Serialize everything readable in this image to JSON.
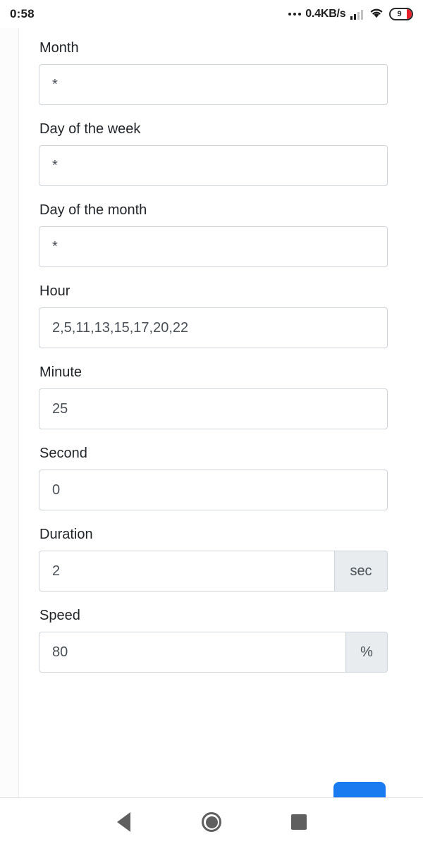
{
  "status_bar": {
    "clock": "0:58",
    "network_speed": "0.4KB/s",
    "battery_level": "9",
    "icons": {
      "more": "three-dots-icon",
      "signal": "signal-bars-icon",
      "wifi": "wifi-icon",
      "battery": "battery-icon"
    }
  },
  "form": {
    "fields": [
      {
        "label": "Month",
        "value": "*",
        "addon": ""
      },
      {
        "label": "Day of the week",
        "value": "*",
        "addon": ""
      },
      {
        "label": "Day of the month",
        "value": "*",
        "addon": ""
      },
      {
        "label": "Hour",
        "value": "2,5,11,13,15,17,20,22",
        "addon": ""
      },
      {
        "label": "Minute",
        "value": "25",
        "addon": ""
      },
      {
        "label": "Second",
        "value": "0",
        "addon": ""
      },
      {
        "label": "Duration",
        "value": "2",
        "addon": "sec"
      },
      {
        "label": "Speed",
        "value": "80",
        "addon": "%"
      }
    ]
  },
  "fab": {
    "name": "save-button",
    "color": "#1a7bf0"
  },
  "nav_bar": {
    "back": "back-icon",
    "home": "home-icon",
    "recents": "recents-icon"
  }
}
